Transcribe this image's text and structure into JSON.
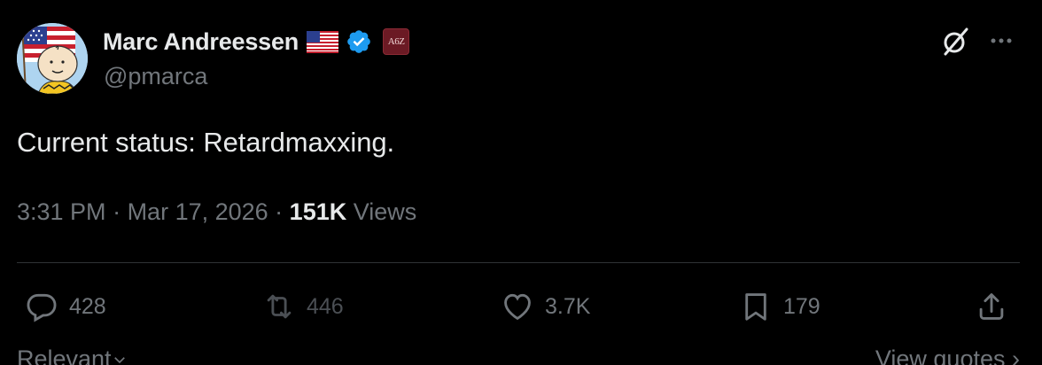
{
  "author": {
    "display_name": "Marc Andreessen",
    "handle": "@pmarca",
    "affiliate_badge_text": "A6Z",
    "avatar_icon": "charlie-brown-with-flag-avatar",
    "flag_icon": "us-flag-emoji",
    "verified_icon": "verified-badge-icon"
  },
  "tweet": {
    "text": "Current status: Retardmaxxing.",
    "time": "3:31 PM",
    "date": "Mar 17, 2026",
    "views_count": "151K",
    "views_label": "Views"
  },
  "actions": {
    "replies": "428",
    "reposts": "446",
    "likes": "3.7K",
    "bookmarks": "179"
  },
  "footer": {
    "sort_label": "Relevant",
    "view_quotes_label": "View quotes"
  },
  "colors": {
    "background": "#000000",
    "primary_text": "#e7e9ea",
    "secondary_text": "#71767b",
    "verified_blue": "#1d9bf0",
    "divider": "#2f3336"
  }
}
